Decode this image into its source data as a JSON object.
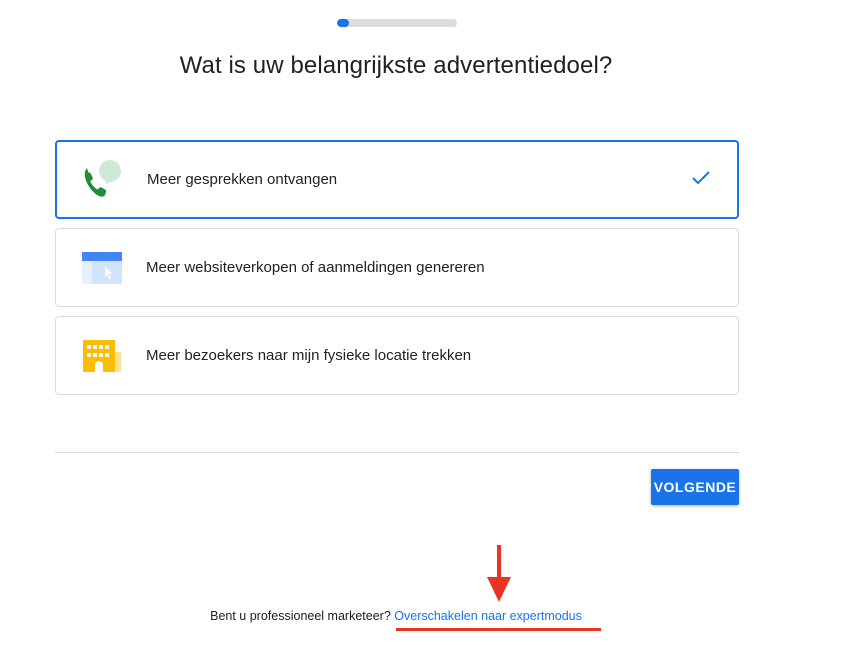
{
  "progress": {
    "fraction": 0.1
  },
  "title": "Wat is uw belangrijkste advertentiedoel?",
  "options": [
    {
      "label": "Meer gesprekken ontvangen",
      "icon": "phone-chat-icon",
      "selected": true
    },
    {
      "label": "Meer websiteverkopen of aanmeldingen genereren",
      "icon": "browser-cursor-icon",
      "selected": false
    },
    {
      "label": "Meer bezoekers naar mijn fysieke locatie trekken",
      "icon": "storefront-building-icon",
      "selected": false
    }
  ],
  "next_button": {
    "label": "VOLGENDE"
  },
  "footer": {
    "question": "Bent u professioneel marketeer?",
    "link": "Overschakelen naar expertmodus"
  },
  "colors": {
    "accent": "#1a73e8",
    "annotation": "#ea3323",
    "border": "#dadce0"
  }
}
